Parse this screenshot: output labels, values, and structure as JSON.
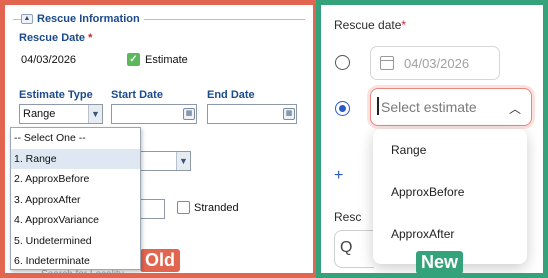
{
  "old": {
    "section_title": "Rescue Information",
    "collapse_symbol": "▲",
    "rescue_date_label": "Rescue Date",
    "required_mark": "*",
    "rescue_date_value": "04/03/2026",
    "estimate_label": "Estimate",
    "estimate_checked": true,
    "estimate_type_label": "Estimate Type",
    "start_date_label": "Start Date",
    "end_date_label": "End Date",
    "estimate_type_value": "Range",
    "dropdown_options": [
      "-- Select One --",
      "1. Range",
      "2. ApproxBefore",
      "3. ApproxAfter",
      "4. ApproxVariance",
      "5. Undetermined",
      "6. Indeterminate"
    ],
    "dropdown_selected_index": 1,
    "stranded_label": "Stranded",
    "partial_search_text": "Search for Locality",
    "tag": "Old"
  },
  "new": {
    "rescue_date_label": "Rescue date",
    "required_mark": "*",
    "date_value": "04/03/2026",
    "estimate_placeholder": "Select estimate",
    "options": [
      "Range",
      "ApproxBefore",
      "ApproxAfter"
    ],
    "add_partial": "+",
    "rescue_partial_label": "Resc",
    "search_partial": "Q",
    "tag": "New",
    "accent_color": "#2b59c3",
    "error_border_color": "#e7857f"
  },
  "colors": {
    "old_frame": "#e2654f",
    "new_frame": "#34a37c",
    "old_label": "#1b4b8a"
  }
}
